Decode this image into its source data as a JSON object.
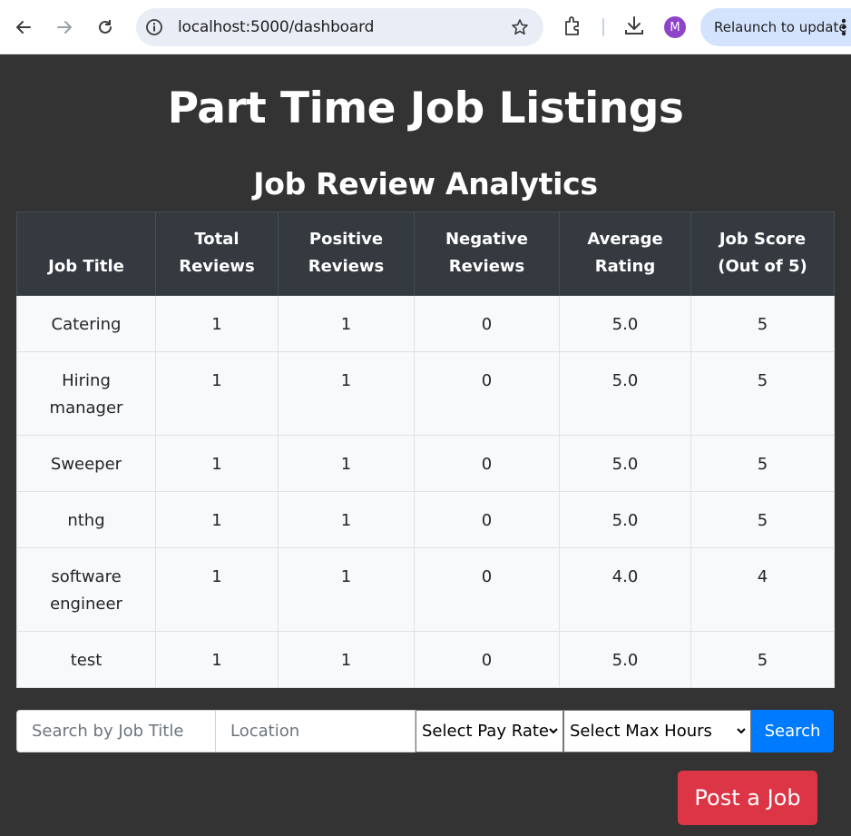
{
  "browser": {
    "url": "localhost:5000/dashboard",
    "relaunch_label": "Relaunch to update",
    "avatar_initial": "M"
  },
  "page": {
    "title": "Part Time Job Listings",
    "analytics_heading": "Job Review Analytics"
  },
  "table": {
    "headers": [
      "Job Title",
      "Total Reviews",
      "Positive Reviews",
      "Negative Reviews",
      "Average Rating",
      "Job Score (Out of 5)"
    ],
    "rows": [
      [
        "Catering",
        "1",
        "1",
        "0",
        "5.0",
        "5"
      ],
      [
        "Hiring manager",
        "1",
        "1",
        "0",
        "5.0",
        "5"
      ],
      [
        "Sweeper",
        "1",
        "1",
        "0",
        "5.0",
        "5"
      ],
      [
        "nthg",
        "1",
        "1",
        "0",
        "5.0",
        "5"
      ],
      [
        "software engineer",
        "1",
        "1",
        "0",
        "4.0",
        "4"
      ],
      [
        "test",
        "1",
        "1",
        "0",
        "5.0",
        "5"
      ]
    ]
  },
  "search": {
    "title_placeholder": "Search by Job Title",
    "location_placeholder": "Location",
    "pay_rate_selected": "Select Pay Rate",
    "max_hours_selected": "Select Max Hours",
    "search_label": "Search"
  },
  "actions": {
    "post_job_label": "Post a Job"
  },
  "colors": {
    "background": "#333333",
    "table_header": "#343a40",
    "primary": "#007bff",
    "danger": "#dc3545"
  }
}
